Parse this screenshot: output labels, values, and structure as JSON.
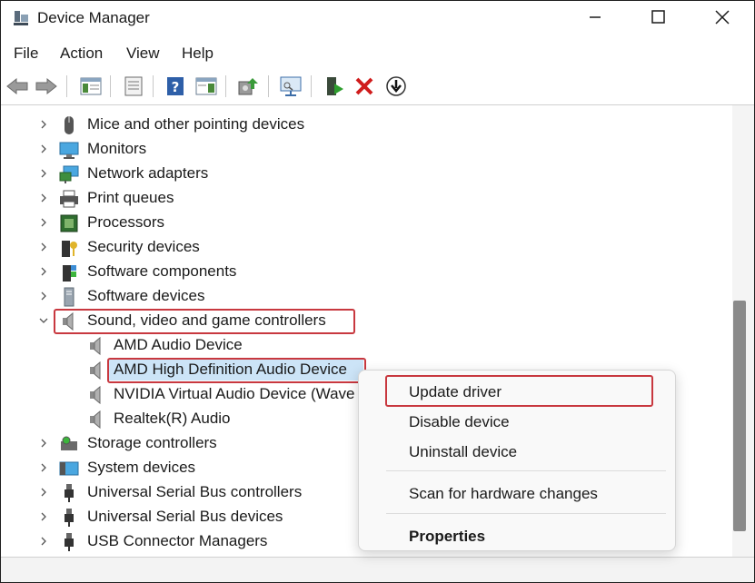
{
  "window": {
    "title": "Device Manager",
    "icon": "device-manager-icon",
    "controls": [
      "minimize-icon",
      "maximize-icon",
      "close-icon"
    ]
  },
  "menu": [
    "File",
    "Action",
    "View",
    "Help"
  ],
  "toolbar": [
    "back-arrow-icon",
    "forward-arrow-icon",
    "show-hide-tree-icon",
    "properties-icon",
    "help-icon",
    "action-pane-icon",
    "update-driver-icon",
    "scan-hardware-icon",
    "enable-device-icon",
    "uninstall-device-icon",
    "disable-device-icon"
  ],
  "tree": {
    "categories_top": [
      {
        "label": "Mice and other pointing devices",
        "icon": "mouse-icon"
      },
      {
        "label": "Monitors",
        "icon": "monitor-icon"
      },
      {
        "label": "Network adapters",
        "icon": "network-adapter-icon"
      },
      {
        "label": "Print queues",
        "icon": "printer-icon"
      },
      {
        "label": "Processors",
        "icon": "processor-icon"
      },
      {
        "label": "Security devices",
        "icon": "security-device-icon"
      },
      {
        "label": "Software components",
        "icon": "software-component-icon"
      },
      {
        "label": "Software devices",
        "icon": "software-device-icon"
      }
    ],
    "expanded_category": {
      "label": "Sound, video and game controllers",
      "icon": "speaker-icon"
    },
    "children": [
      {
        "label": "AMD Audio Device",
        "icon": "speaker-icon"
      },
      {
        "label": "AMD High Definition Audio Device",
        "icon": "speaker-icon"
      },
      {
        "label": "NVIDIA Virtual Audio Device (Wave",
        "icon": "speaker-icon"
      },
      {
        "label": "Realtek(R) Audio",
        "icon": "speaker-icon"
      }
    ],
    "categories_bottom": [
      {
        "label": "Storage controllers",
        "icon": "storage-controller-icon"
      },
      {
        "label": "System devices",
        "icon": "system-device-icon"
      },
      {
        "label": "Universal Serial Bus controllers",
        "icon": "usb-icon"
      },
      {
        "label": "Universal Serial Bus devices",
        "icon": "usb-icon"
      },
      {
        "label": "USB Connector Managers",
        "icon": "usb-icon"
      }
    ]
  },
  "context_menu": {
    "update_driver": "Update driver",
    "disable_device": "Disable device",
    "uninstall_device": "Uninstall device",
    "scan_hardware": "Scan for hardware changes",
    "properties": "Properties"
  },
  "colors": {
    "highlight_border": "#c8383f",
    "selection": "#cce4f7"
  }
}
